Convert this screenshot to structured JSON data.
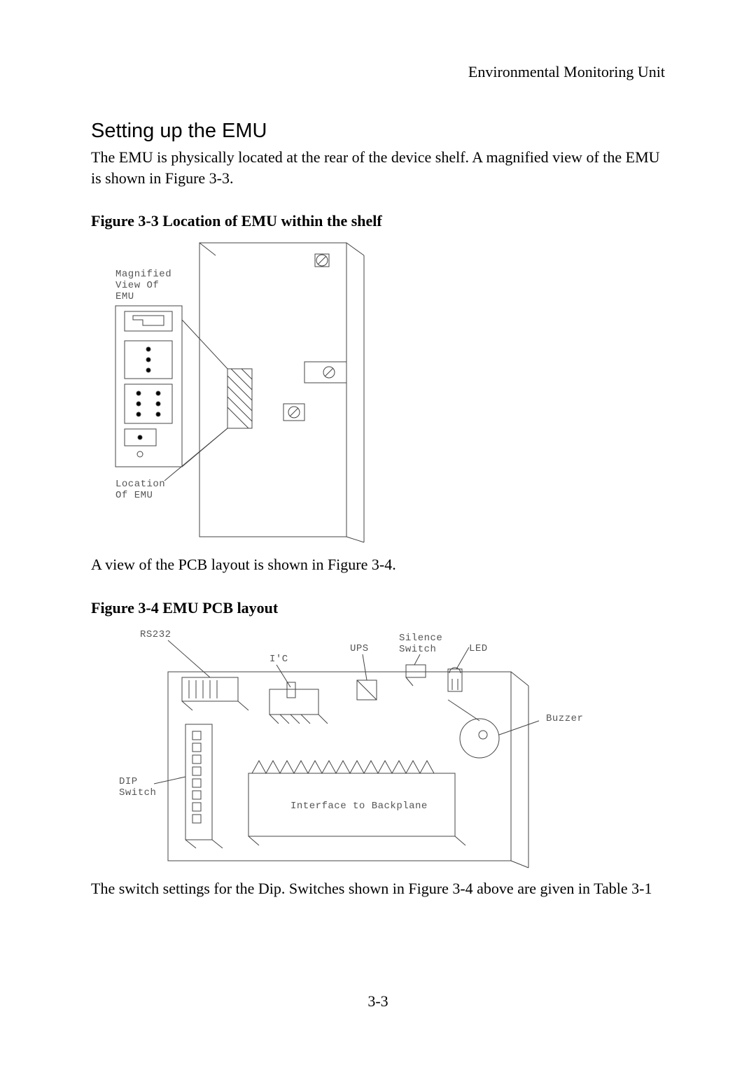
{
  "header": {
    "right": "Environmental Monitoring Unit"
  },
  "section": {
    "title": "Setting up the EMU"
  },
  "para1": "The EMU is physically located at the rear of the device shelf. A magnified view of the EMU is shown in Figure 3-3.",
  "fig33": {
    "caption": "Figure 3-3 Location of EMU within the shelf",
    "label_magnified_l1": "Magnified",
    "label_magnified_l2": "View Of",
    "label_magnified_l3": "EMU",
    "label_location_l1": "Location",
    "label_location_l2": "Of EMU"
  },
  "para2": "A view of the PCB layout is shown in Figure 3-4.",
  "fig34": {
    "caption": "Figure 3-4 EMU PCB layout",
    "label_rs232": "RS232",
    "label_ic": "I'C",
    "label_ups": "UPS",
    "label_silence_l1": "Silence",
    "label_silence_l2": "Switch",
    "label_led": "LED",
    "label_buzzer": "Buzzer",
    "label_dip_l1": "DIP",
    "label_dip_l2": "Switch",
    "label_backplane": "Interface to Backplane"
  },
  "para3": "The switch settings for the Dip. Switches shown in Figure 3-4 above are given in Table 3-1",
  "pagenum": "3-3"
}
